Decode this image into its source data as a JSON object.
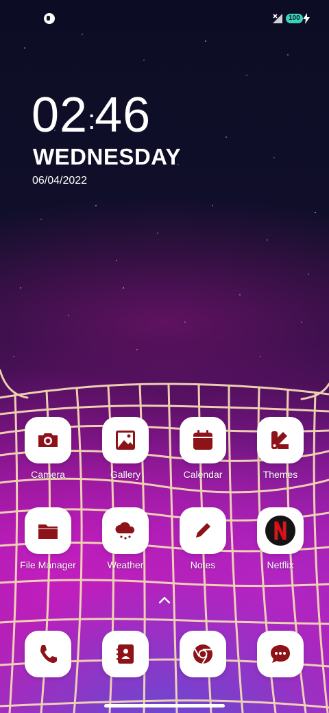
{
  "status_bar": {
    "battery_level": "100",
    "left_icon": "app-notification-icon",
    "signal_icon": "no-signal-icon",
    "charging_icon": "charging-bolt-icon"
  },
  "lockscreen_clock": {
    "hours": "02",
    "minutes": "46",
    "weekday": "WEDNESDAY",
    "date": "06/04/2022"
  },
  "icon_color": "#8e1319",
  "apps_row1": [
    {
      "label": "Camera",
      "icon": "camera-icon"
    },
    {
      "label": "Gallery",
      "icon": "image-icon"
    },
    {
      "label": "Calendar",
      "icon": "calendar-icon"
    },
    {
      "label": "Themes",
      "icon": "themes-icon"
    }
  ],
  "apps_row2": [
    {
      "label": "File Manager",
      "icon": "folder-icon"
    },
    {
      "label": "Weather",
      "icon": "weather-icon"
    },
    {
      "label": "Notes",
      "icon": "pencil-icon"
    },
    {
      "label": "Netflix",
      "icon": "netflix-icon"
    }
  ],
  "dock": [
    {
      "app": "Phone",
      "icon": "phone-icon"
    },
    {
      "app": "Contacts",
      "icon": "contacts-icon"
    },
    {
      "app": "Chrome",
      "icon": "chrome-icon"
    },
    {
      "app": "Messages",
      "icon": "messages-icon"
    }
  ]
}
